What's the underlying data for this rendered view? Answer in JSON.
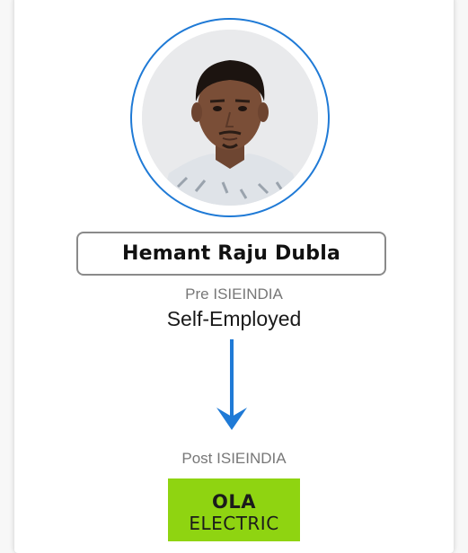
{
  "profile": {
    "name": "Hemant Raju Dubla",
    "photo_alt": "profile photo"
  },
  "pre": {
    "label": "Pre ISIEINDIA",
    "company": "Self-Employed"
  },
  "post": {
    "label": "Post ISIEINDIA",
    "logo_line1": "OLA",
    "logo_line2": "ELECTRIC"
  },
  "icons": {
    "transition": "arrow-down-icon"
  },
  "colors": {
    "accent": "#1f7ad6",
    "logo_background": "#8fd411",
    "name_border": "#8a8a8a"
  }
}
